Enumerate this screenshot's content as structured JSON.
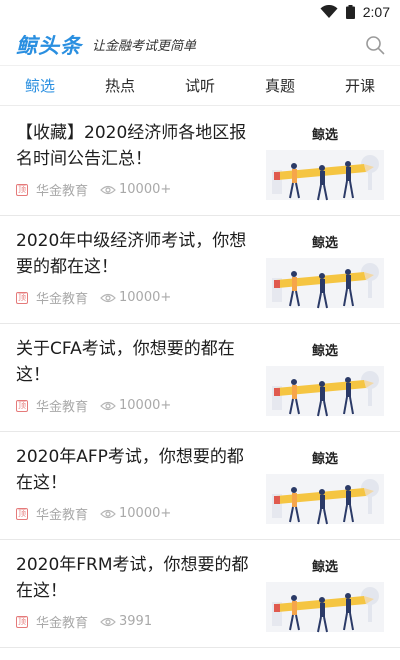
{
  "status": {
    "time": "2:07"
  },
  "header": {
    "logo": "鲸头条",
    "slogan": "让金融考试更简单"
  },
  "tabs": [
    {
      "label": "鲸选",
      "active": true
    },
    {
      "label": "热点"
    },
    {
      "label": "试听"
    },
    {
      "label": "真题"
    },
    {
      "label": "开课"
    }
  ],
  "articles": [
    {
      "title": "【收藏】2020经济师各地区报名时间公告汇总！",
      "source": "华金教育",
      "source_badge": "顶",
      "views": "10000+",
      "thumb_label": "鲸选"
    },
    {
      "title": "2020年中级经济师考试，你想要的都在这！",
      "source": "华金教育",
      "source_badge": "顶",
      "views": "10000+",
      "thumb_label": "鲸选"
    },
    {
      "title": "关于CFA考试，你想要的都在这！",
      "source": "华金教育",
      "source_badge": "顶",
      "views": "10000+",
      "thumb_label": "鲸选"
    },
    {
      "title": "2020年AFP考试，你想要的都在这！",
      "source": "华金教育",
      "source_badge": "顶",
      "views": "10000+",
      "thumb_label": "鲸选"
    },
    {
      "title": "2020年FRM考试，你想要的都在这！",
      "source": "华金教育",
      "source_badge": "顶",
      "views": "3991",
      "thumb_label": "鲸选"
    }
  ],
  "colors": {
    "accent": "#2a8fe0",
    "pencil": "#f5c542",
    "figure": "#2b3a67"
  }
}
